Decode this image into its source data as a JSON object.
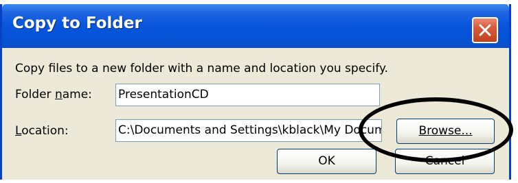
{
  "dialog": {
    "title": "Copy to Folder",
    "description": "Copy files to a new folder with a name and location you specify.",
    "close_icon": "close-icon"
  },
  "folder_name": {
    "label_before": "Folder ",
    "label_mnemonic": "n",
    "label_after": "ame:",
    "value": "PresentationCD"
  },
  "location": {
    "label_mnemonic": "L",
    "label_after": "ocation:",
    "value": "C:\\Documents and Settings\\kblack\\My Documents"
  },
  "buttons": {
    "browse": "Browse...",
    "ok": "OK",
    "cancel": "Cancel"
  },
  "colors": {
    "titlebar": "#0553d8",
    "dialog_bg": "#ece9d8",
    "close_button": "#d65a3a"
  }
}
